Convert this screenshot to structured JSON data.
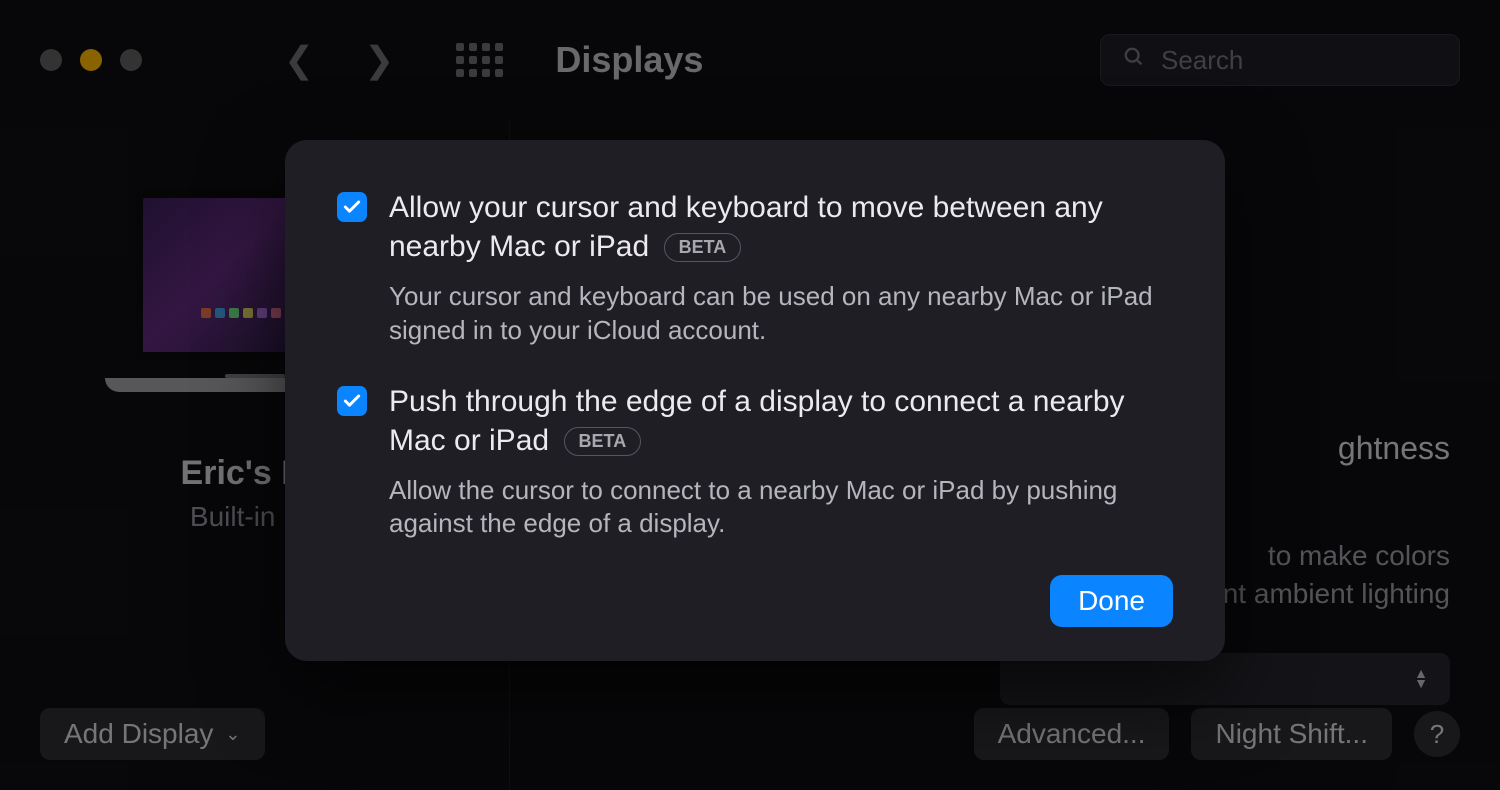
{
  "toolbar": {
    "title": "Displays",
    "search_placeholder": "Search"
  },
  "left_pane": {
    "display_name": "Eric's Ma",
    "display_sub": "Built-in Re"
  },
  "right_pane": {
    "brightness_heading_fragment": "ghtness",
    "true_tone_line1_fragment": "to make colors",
    "true_tone_line2_fragment": "nt ambient lighting"
  },
  "modal": {
    "options": [
      {
        "title": "Allow your cursor and keyboard to move between any nearby Mac or iPad",
        "badge": "BETA",
        "description": "Your cursor and keyboard can be used on any nearby Mac or iPad signed in to your iCloud account.",
        "checked": true
      },
      {
        "title": "Push through the edge of a display to connect a nearby Mac or iPad",
        "badge": "BETA",
        "description": "Allow the cursor to connect to a nearby Mac or iPad by pushing against the edge of a display.",
        "checked": true
      }
    ],
    "done_label": "Done"
  },
  "bottom": {
    "add_display": "Add Display",
    "advanced": "Advanced...",
    "night_shift": "Night Shift...",
    "help": "?"
  },
  "colors": {
    "accent": "#0a84ff"
  }
}
